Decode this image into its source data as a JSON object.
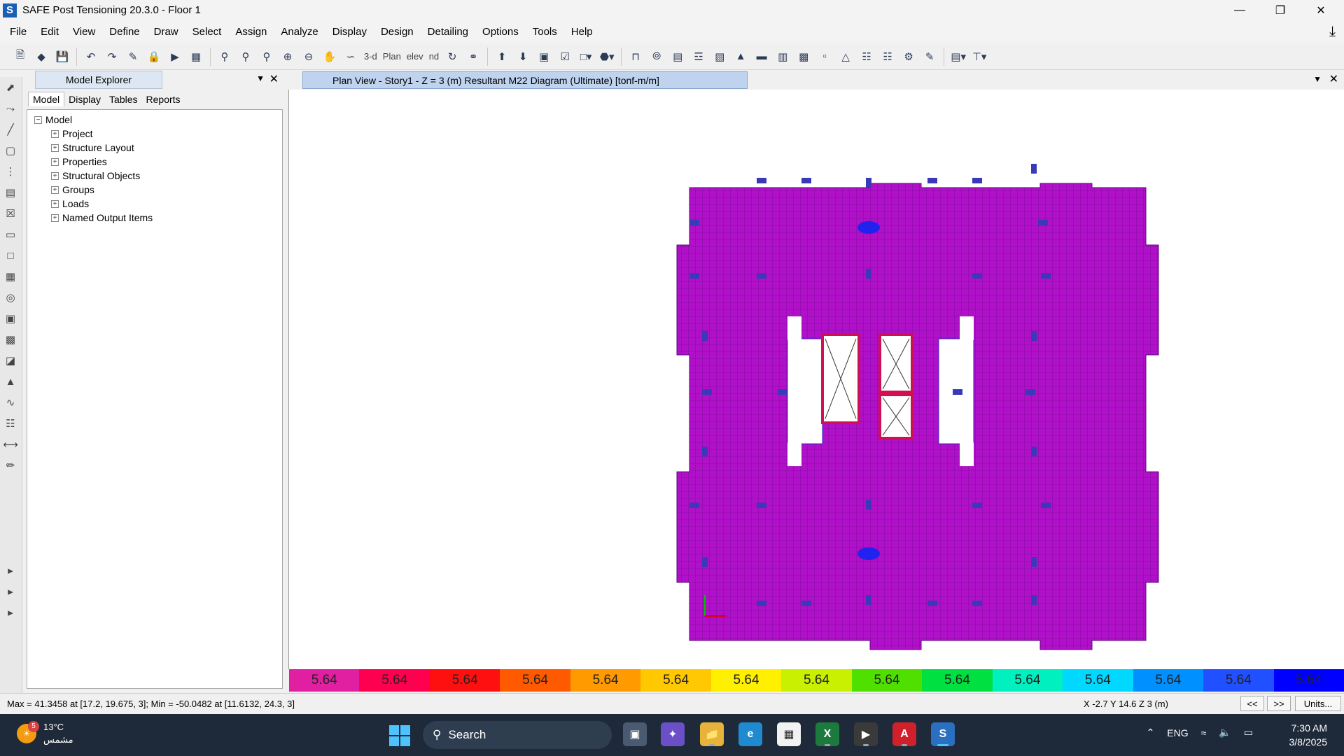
{
  "window": {
    "title": "SAFE Post Tensioning 20.3.0 - Floor 1",
    "app_icon_letter": "S"
  },
  "menu": [
    "File",
    "Edit",
    "View",
    "Define",
    "Draw",
    "Select",
    "Assign",
    "Analyze",
    "Display",
    "Design",
    "Detailing",
    "Options",
    "Tools",
    "Help"
  ],
  "toolbar": {
    "view_3d": "3-d",
    "view_plan": "Plan",
    "view_elev": "elev",
    "view_nd": "nd"
  },
  "explorer": {
    "title": "Model Explorer",
    "tabs": [
      "Model",
      "Display",
      "Tables",
      "Reports"
    ],
    "active_tab": "Model",
    "root": "Model",
    "items": [
      "Project",
      "Structure Layout",
      "Properties",
      "Structural Objects",
      "Groups",
      "Loads",
      "Named Output Items"
    ]
  },
  "view": {
    "tab_title": "Plan View - Story1 - Z = 3 (m)   Resultant M22 Diagram   (Ultimate)  [tonf-m/m]"
  },
  "legend": {
    "values": [
      "5.64",
      "5.64",
      "5.64",
      "5.64",
      "5.64",
      "5.64",
      "5.64",
      "5.64",
      "5.64",
      "5.64",
      "5.64",
      "5.64",
      "5.64",
      "5.64",
      "5.64"
    ],
    "colors": [
      "#e020a0",
      "#ff0050",
      "#ff1010",
      "#ff5a00",
      "#ff9a00",
      "#ffc800",
      "#fff000",
      "#c8f000",
      "#50e000",
      "#00e040",
      "#00f0c0",
      "#00d8ff",
      "#0090ff",
      "#2050ff",
      "#0000ff"
    ]
  },
  "status": {
    "left": "Max = 41.3458 at [17.2, 19.675, 3];  Min = -50.0482 at [11.6132, 24.3, 3]",
    "coords": "X -2.7  Y 14.6  Z 3 (m)",
    "prev": "<<",
    "next": ">>",
    "units": "Units..."
  },
  "taskbar": {
    "weather_temp": "13°C",
    "weather_desc": "مشمس",
    "weather_badge": "5",
    "search_label": "Search",
    "lang": "ENG",
    "time": "7:30 AM",
    "date": "3/8/2025"
  },
  "plot_colors": {
    "slab": "#b010c8",
    "mesh": "#7a0a9a",
    "beam": "#2b2bd0",
    "opening": "#ffffff",
    "core_wall": "#d01050"
  }
}
